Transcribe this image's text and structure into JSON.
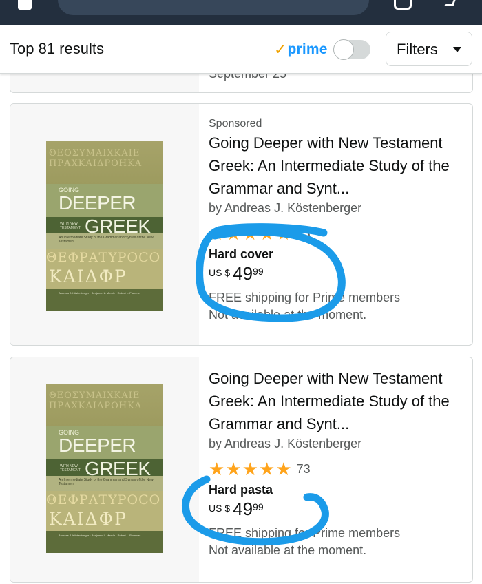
{
  "colors": {
    "appbar": "#232f3e",
    "prime_blue": "#1a98ff",
    "prime_check": "#f0a200",
    "star": "#ffa41c",
    "annotation": "#1b9be9"
  },
  "header": {
    "results_label": "Top 81 results",
    "prime_check": "✓",
    "prime_label": "prime",
    "prime_toggle": "off",
    "filters_label": "Filters"
  },
  "products": [
    {
      "delivery": "September 25"
    },
    {
      "sponsored": "Sponsored",
      "title": "Going Deeper with New Testament Greek: An Intermediate Study of the Grammar and Synt...",
      "byline": "by Andreas J. Köstenberger",
      "rating_stars": 4.5,
      "rating_count": "73",
      "format": "Hard cover",
      "price_currency": "US $",
      "price_whole": "49",
      "price_fraction": "99",
      "shipping": "FREE shipping for Prime members",
      "availability": "Not available at the moment.",
      "cover": {
        "going": "GOING",
        "deeper": "DEEPER",
        "with_new": "WITH NEW TESTAMENT",
        "greek": "GREEK",
        "subtitle": "An Intermediate Study of the Grammar and Syntax of the New Testament",
        "script_line1": "ΘΕΦΡΑΤΥΡΟCΟ",
        "script_line2": "ΚΑΙΔΦΡ",
        "authors": "Andreas J. Köstenberger · Benjamin L. Merkle · Robert L. Plummer"
      }
    },
    {
      "title": "Going Deeper with New Testament Greek: An Intermediate Study of the Grammar and Synt...",
      "byline": "by Andreas J. Köstenberger",
      "rating_stars": 4.5,
      "rating_count": "73",
      "format": "Hard pasta",
      "price_currency": "US $",
      "price_whole": "49",
      "price_fraction": "99",
      "shipping": "FREE shipping for Prime members",
      "availability": "Not available at the moment.",
      "cover": {
        "going": "GOING",
        "deeper": "DEEPER",
        "with_new": "WITH NEW TESTAMENT",
        "greek": "GREEK",
        "subtitle": "An Intermediate Study of the Grammar and Syntax of the New Testament",
        "script_line1": "ΘΕΦΡΑΤΥΡΟCΟ",
        "script_line2": "ΚΑΙΔΦΡ",
        "authors": "Andreas J. Köstenberger · Benjamin L. Merkle · Robert L. Plummer"
      }
    }
  ]
}
